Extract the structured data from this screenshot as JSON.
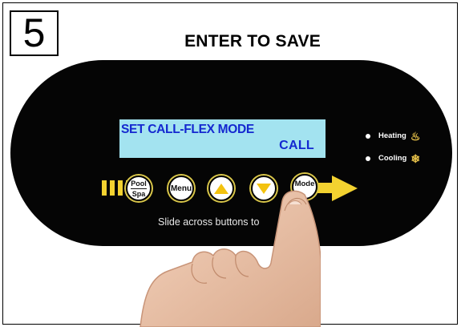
{
  "step": {
    "number": "5"
  },
  "title": "ENTER TO SAVE",
  "lcd": {
    "line1": "SET CALL-FLEX MODE",
    "line2": "CALL"
  },
  "indicators": [
    {
      "label": "Heating",
      "icon": "flame-icon"
    },
    {
      "label": "Cooling",
      "icon": "snowflake-icon"
    }
  ],
  "buttons": {
    "pool_top": "Pool",
    "pool_bottom": "Spa",
    "menu": "Menu",
    "up": "up-arrow-icon",
    "down": "down-arrow-icon",
    "mode": "Mode"
  },
  "hint": "Slide across buttons to",
  "colors": {
    "panel": "#050505",
    "lcd_bg": "#a3e3f0",
    "lcd_text": "#1428d0",
    "accent": "#f3d230"
  }
}
